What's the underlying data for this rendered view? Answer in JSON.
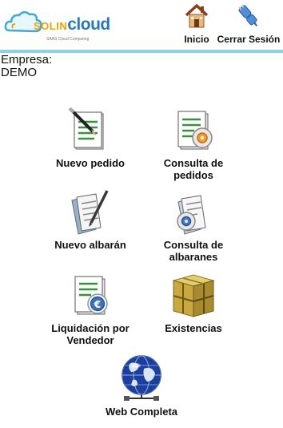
{
  "brand": {
    "solin": "SOLIN",
    "cloud": "cloud",
    "tagline": "SAAS Cloud Computing"
  },
  "header": {
    "inicio_label": "Inicio",
    "logout_label": "Cerrar Sesión"
  },
  "company": {
    "label": "Empresa:",
    "name": "DEMO"
  },
  "menu": [
    {
      "label": "Nuevo pedido",
      "icon": "new-order-icon"
    },
    {
      "label": "Consulta de\npedidos",
      "icon": "order-query-icon"
    },
    {
      "label": "Nuevo albarán",
      "icon": "new-delivery-note-icon"
    },
    {
      "label": "Consulta de\nalbaranes",
      "icon": "delivery-note-query-icon"
    },
    {
      "label": "Liquidación por\nVendedor",
      "icon": "seller-settlement-icon"
    },
    {
      "label": "Existencias",
      "icon": "stock-box-icon"
    },
    {
      "label": "Web Completa",
      "icon": "globe-network-icon"
    }
  ]
}
